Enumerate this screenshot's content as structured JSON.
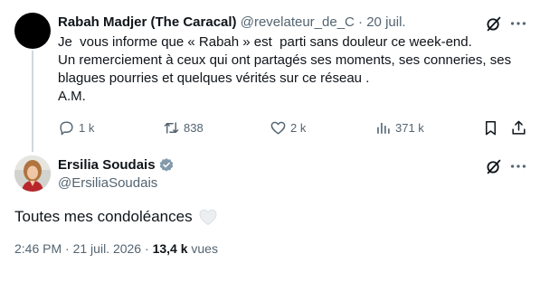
{
  "tweet1": {
    "display_name": "Rabah Madjer (The Caracal)",
    "handle": "@revelateur_de_C",
    "separator": "·",
    "date": "20 juil.",
    "lines": [
      "Je  vous informe que « Rabah » est  parti sans douleur ce week-end.",
      "Un remerciement à ceux qui ont partagés ses moments, ses conneries, ses",
      "blagues pourries et quelques vérités sur ce réseau .",
      "A.M."
    ],
    "actions": {
      "replies": "1 k",
      "retweets": "838",
      "likes": "2 k",
      "views": "371 k"
    },
    "icons": [
      "grok-icon",
      "more-icon",
      "reply-icon",
      "retweet-icon",
      "like-icon",
      "views-icon",
      "bookmark-icon",
      "share-icon"
    ]
  },
  "tweet2": {
    "display_name": "Ersilia Soudais",
    "handle": "@ErsiliaSoudais",
    "text": "Toutes mes condoléances",
    "time": "2:46 PM",
    "separator": "·",
    "date": "21 juil. 2026",
    "views_count": "13,4 k",
    "views_label": "vues",
    "verified_color": "#829aab",
    "icons": [
      "verified-badge-icon",
      "white-heart-icon",
      "grok-icon",
      "more-icon"
    ]
  },
  "colors": {
    "text": "#0f1419",
    "muted": "#536471",
    "thread_line": "#cfd9de"
  }
}
